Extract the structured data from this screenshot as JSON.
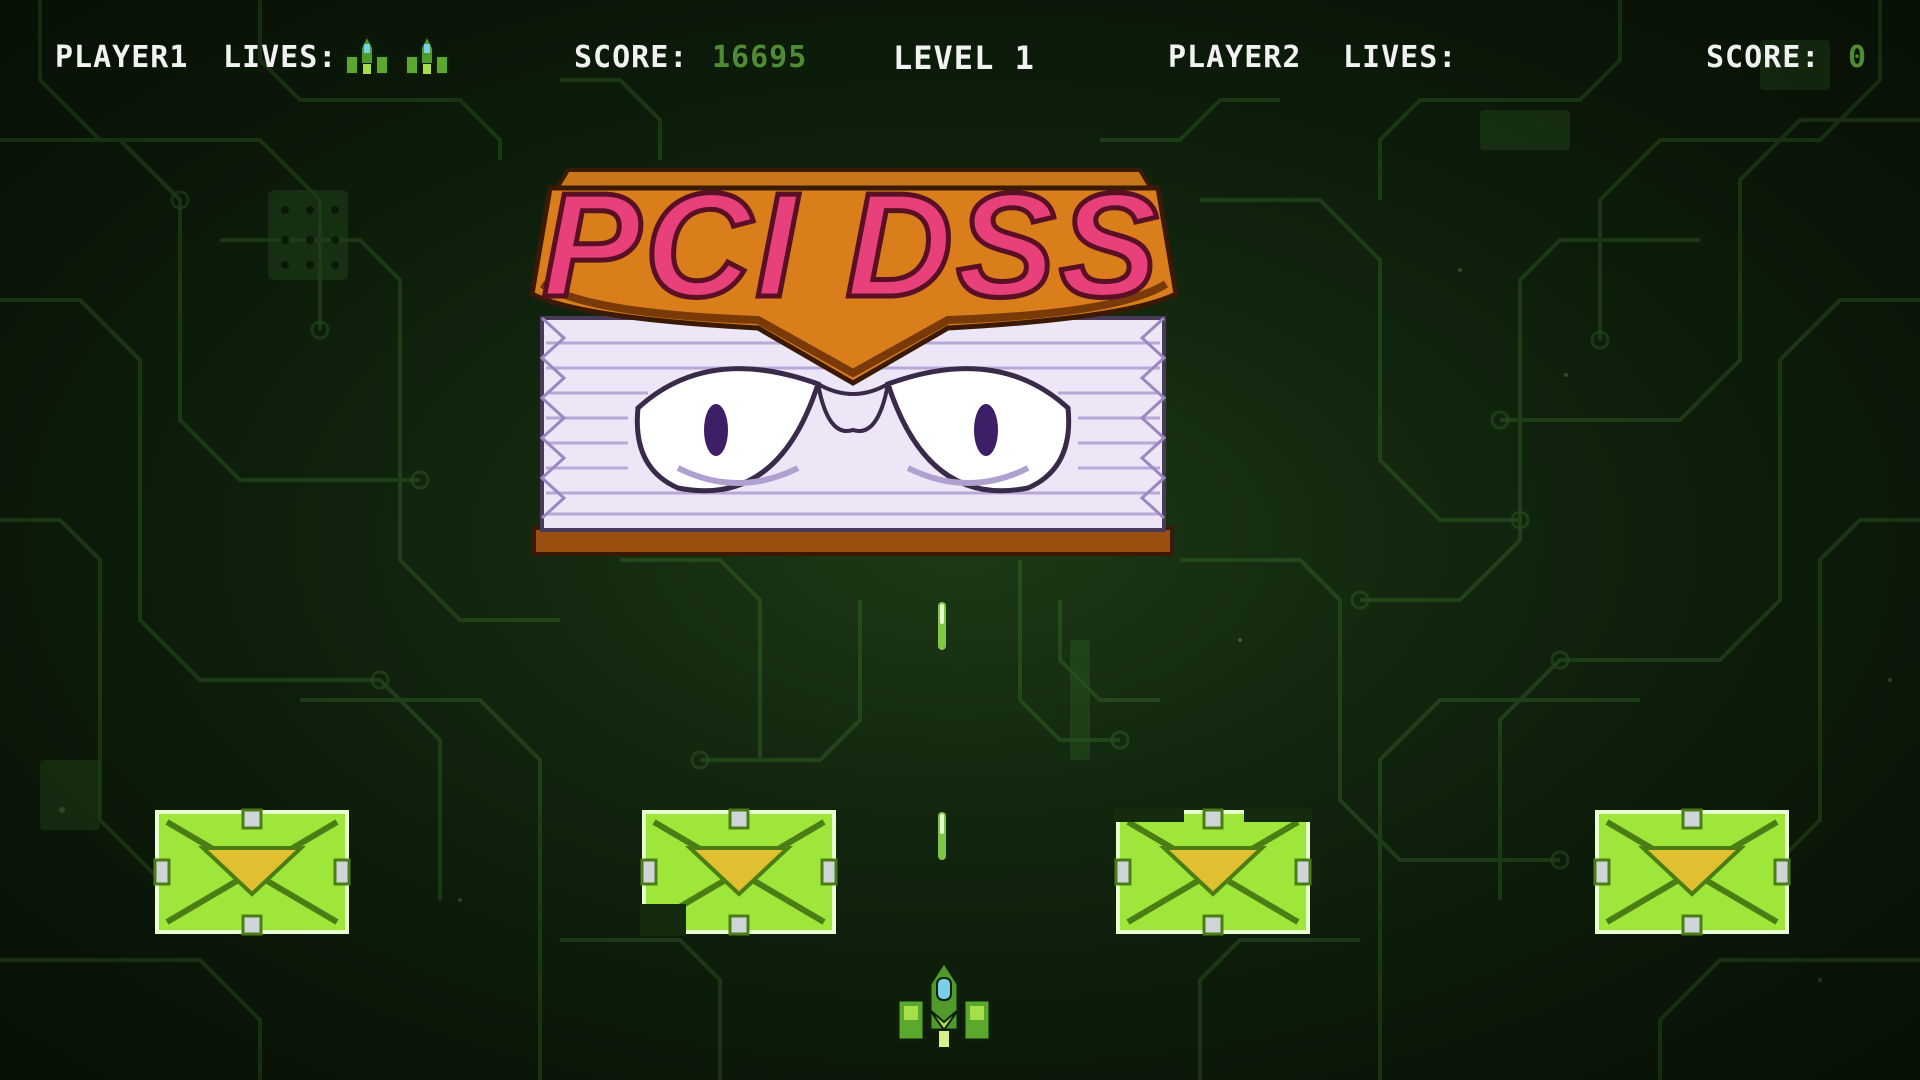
{
  "hud": {
    "player1_label": "PLAYER1",
    "player1_lives_label": "LIVES:",
    "player1_lives_count": 2,
    "player1_score_label": "SCORE:",
    "player1_score": "16695",
    "level_label": "LEVEL 1",
    "player2_label": "PLAYER2",
    "player2_lives_label": "LIVES:",
    "player2_lives_count": 0,
    "player2_score_label": "SCORE:",
    "player2_score": "0"
  },
  "boss": {
    "title": "PCI DSS",
    "title_color": "#e8407a",
    "cover_color": "#d97e1a",
    "pages_color": "#ece6f6"
  },
  "shields": [
    "shield",
    "shield",
    "shield",
    "shield"
  ],
  "shots": [
    "shot",
    "shot"
  ],
  "colors": {
    "background": "#142b10",
    "circuit": "#2c5a22",
    "hud_text": "#f2f2f2",
    "score_value": "#4f8a34",
    "shield_green": "#9ee63a",
    "shield_dark": "#4a7d14",
    "shield_accent": "#e0c030",
    "laser": "#8ad84a"
  },
  "icons": [
    "ship-icon",
    "shield-block",
    "laser-shot",
    "boss-book"
  ]
}
